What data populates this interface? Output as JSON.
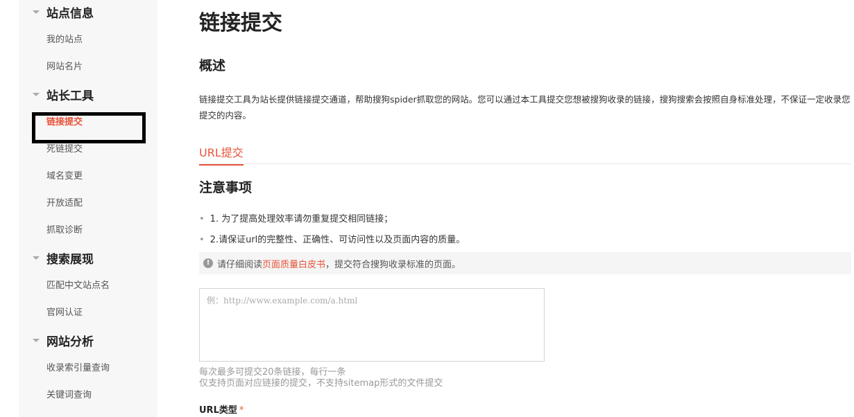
{
  "sidebar": {
    "groups": [
      {
        "title": "站点信息",
        "items": [
          {
            "label": "我的站点"
          },
          {
            "label": "网站名片"
          }
        ]
      },
      {
        "title": "站长工具",
        "items": [
          {
            "label": "链接提交"
          },
          {
            "label": "死链提交"
          },
          {
            "label": "域名变更"
          },
          {
            "label": "开放适配"
          },
          {
            "label": "抓取诊断"
          }
        ]
      },
      {
        "title": "搜索展现",
        "items": [
          {
            "label": "匹配中文站点名"
          },
          {
            "label": "官网认证"
          }
        ]
      },
      {
        "title": "网站分析",
        "items": [
          {
            "label": "收录索引量查询"
          },
          {
            "label": "关键词查询"
          }
        ]
      }
    ],
    "active_item": "链接提交"
  },
  "main": {
    "title": "链接提交",
    "overview_heading": "概述",
    "overview_text": "链接提交工具为站长提供链接提交通道，帮助搜狗spider抓取您的网站。您可以通过本工具提交您想被搜狗收录的链接，搜狗搜索会按照自身标准处理，不保证一定收录您提交的内容。",
    "tab_label": "URL提交",
    "notes_heading": "注意事项",
    "notes": [
      "1. 为了提高处理效率请勿重复提交相同链接；",
      "2.请保证url的完整性、正确性、可访问性以及页面内容的质量。"
    ],
    "tip": {
      "prefix": "请仔细阅读",
      "link": "页面质量白皮书",
      "suffix": "，提交符合搜狗收录标准的页面。"
    },
    "url_input": {
      "placeholder": "例：http://www.example.com/a.html",
      "value": ""
    },
    "hints": [
      "每次最多可提交20条链接，每行一条",
      "仅支持页面对应链接的提交，不支持sitemap形式的文件提交"
    ],
    "url_type_label": "URL类型",
    "required_mark": "*"
  },
  "colors": {
    "accent": "#e8533a",
    "sidebar_bg": "#f7f7f7"
  }
}
